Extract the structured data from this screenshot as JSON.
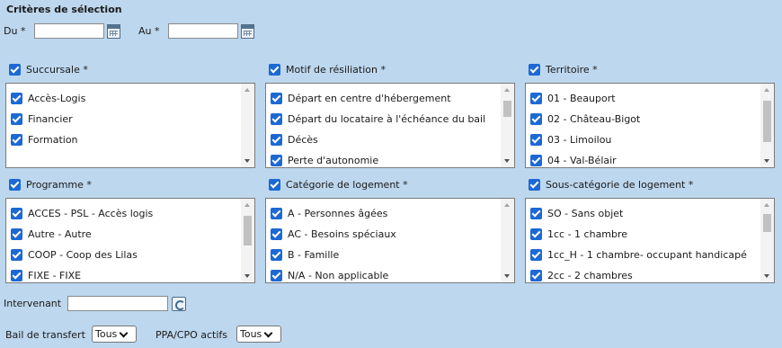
{
  "page": {
    "title": "Critères de sélection"
  },
  "dates": {
    "du_label": "Du *",
    "au_label": "Au *",
    "du_value": "",
    "au_value": ""
  },
  "groups": {
    "succursale": {
      "label": "Succursale *",
      "items": [
        "Accès-Logis",
        "Financier",
        "Formation"
      ]
    },
    "motif": {
      "label": "Motif de résiliation *",
      "items": [
        "Départ en centre d'hébergement",
        "Départ du locataire à l'échéance du bail",
        "Décès",
        "Perte d'autonomie"
      ]
    },
    "territoire": {
      "label": "Territoire *",
      "items": [
        "01 - Beauport",
        "02 - Château-Bigot",
        "03 - Limoilou",
        "04 - Val-Bélair"
      ]
    },
    "programme": {
      "label": "Programme *",
      "items": [
        "ACCES - PSL - Accès logis",
        "Autre - Autre",
        "COOP - Coop des Lilas",
        "FIXE - FIXE"
      ]
    },
    "categorie": {
      "label": "Catégorie de logement *",
      "items": [
        "A - Personnes âgées",
        "AC - Besoins spéciaux",
        "B - Famille",
        "N/A - Non applicable"
      ]
    },
    "souscategorie": {
      "label": "Sous-catégorie de logement *",
      "items": [
        "SO - Sans objet",
        "1cc - 1 chambre",
        "1cc_H - 1 chambre- occupant handicapé",
        "2cc - 2 chambres"
      ]
    }
  },
  "intervenant": {
    "label": "Intervenant",
    "value": ""
  },
  "bail": {
    "label": "Bail de transfert",
    "value": "Tous"
  },
  "ppa": {
    "label": "PPA/CPO actifs",
    "value": "Tous"
  }
}
